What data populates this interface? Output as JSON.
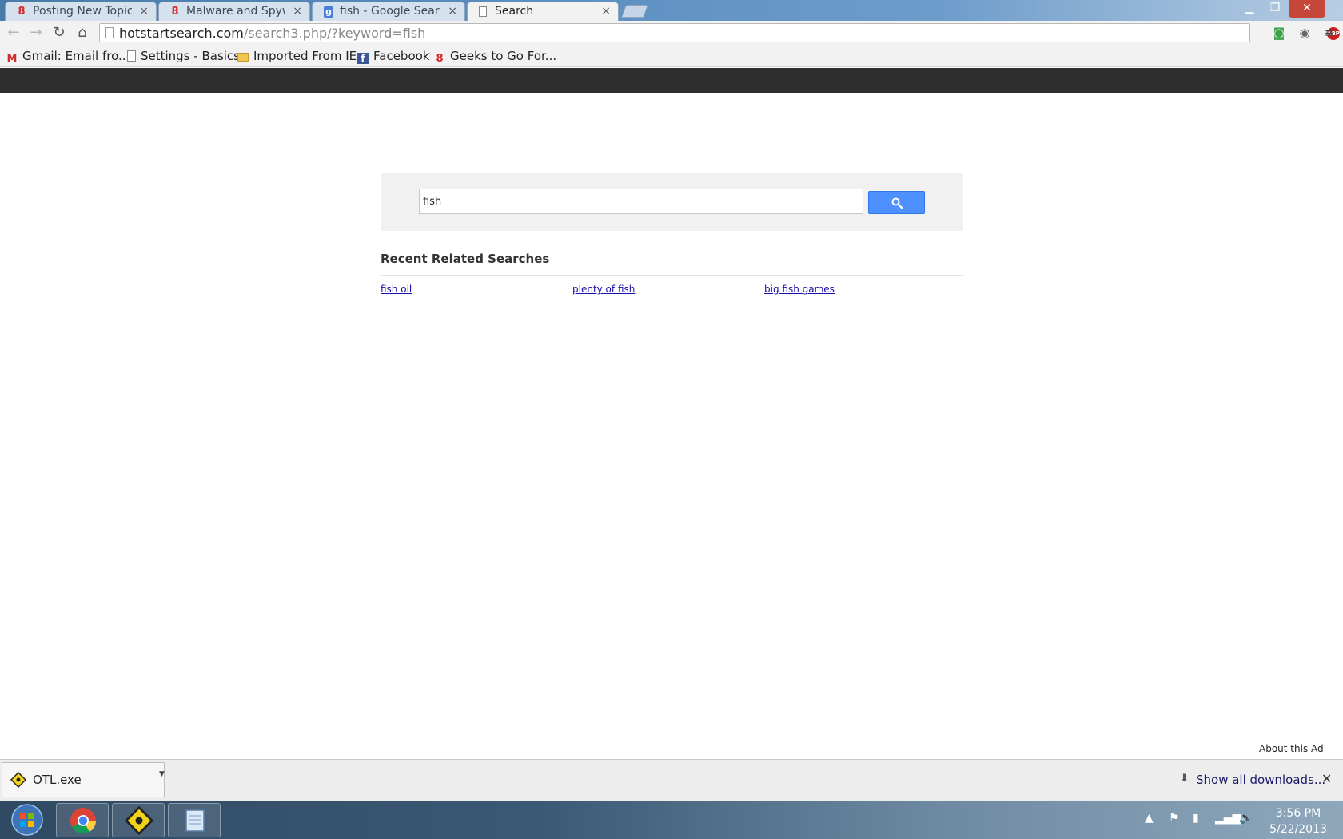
{
  "browser": {
    "tabs": [
      {
        "label": "Posting New Topic - ",
        "icon": "geeks-icon",
        "active": false
      },
      {
        "label": "Malware and Spywar",
        "icon": "geeks-icon",
        "active": false
      },
      {
        "label": "fish - Google Search",
        "icon": "google-icon",
        "active": false
      },
      {
        "label": "Search",
        "icon": "document-icon",
        "active": true
      }
    ],
    "tab_close_glyph": "×",
    "url_host": "hotstartsearch.com",
    "url_path": "/search3.php/?keyword=fish",
    "bookmarks": [
      {
        "label": "Gmail: Email fro...",
        "icon": "gmail-icon"
      },
      {
        "label": "Settings - Basics",
        "icon": "document-icon"
      },
      {
        "label": "Imported From IE",
        "icon": "folder-icon"
      },
      {
        "label": "Facebook",
        "icon": "facebook-icon"
      },
      {
        "label": "Geeks to Go For...",
        "icon": "geeks-icon"
      }
    ],
    "extensions": {
      "abp_label": "ABP"
    }
  },
  "page": {
    "search_value": "fish",
    "related_title": "Recent Related Searches",
    "related_links": [
      "fish oil",
      "plenty of fish",
      "big fish games"
    ],
    "about_ad": "About this Ad"
  },
  "downloads": {
    "file_name": "OTL.exe",
    "show_all": "Show all downloads..."
  },
  "taskbar": {
    "time": "3:56 PM",
    "date": "5/22/2013"
  },
  "colors": {
    "search_button": "#4d90fe",
    "site_bar": "#2e2e2e",
    "link": "#1a0dab"
  }
}
